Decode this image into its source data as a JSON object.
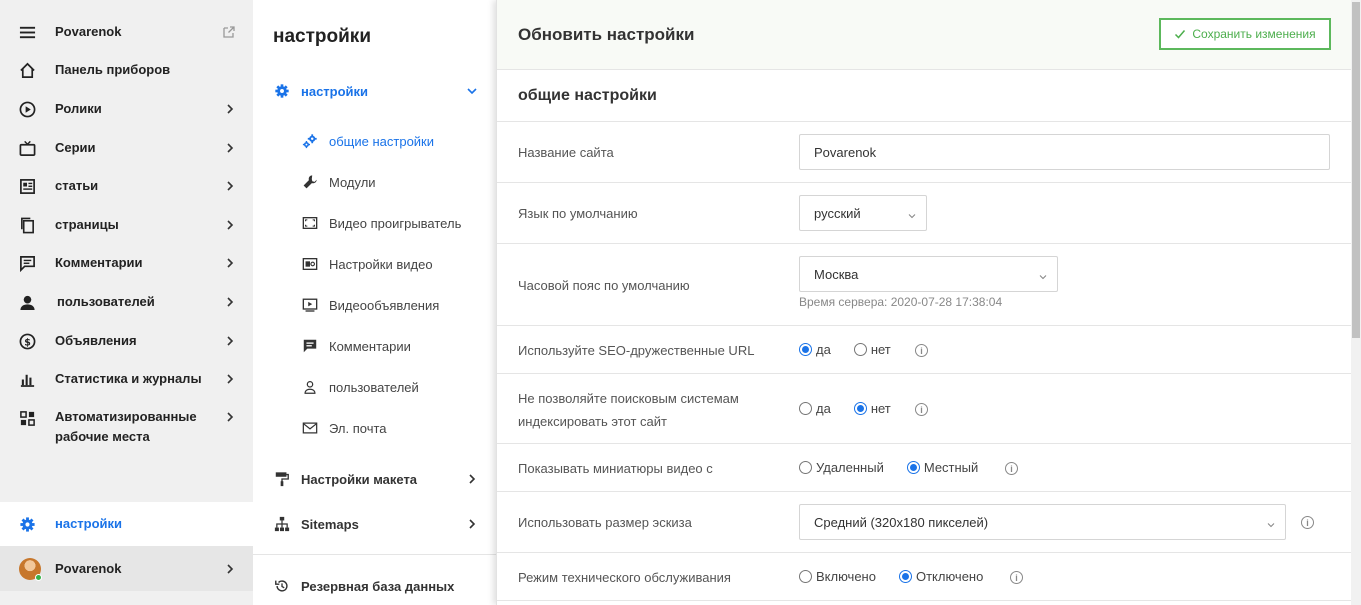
{
  "sidebar": {
    "items": [
      {
        "label": "Povarenok",
        "icon": "menu-icon"
      },
      {
        "label": "Панель приборов",
        "icon": "home-icon"
      },
      {
        "label": "Ролики",
        "icon": "play-circle-icon"
      },
      {
        "label": "Серии",
        "icon": "tv-icon"
      },
      {
        "label": "статьи",
        "icon": "newspaper-icon"
      },
      {
        "label": "страницы",
        "icon": "pages-icon"
      },
      {
        "label": "Комментарии",
        "icon": "comment-icon"
      },
      {
        "label": "пользователей",
        "icon": "user-icon"
      },
      {
        "label": "Объявления",
        "icon": "dollar-icon"
      },
      {
        "label": "Статистика и журналы",
        "icon": "bar-chart-icon"
      },
      {
        "label": "Автоматизированные рабочие места",
        "label_line1": "Автоматизированные",
        "label_line2": "рабочие места",
        "icon": "workstation-icon"
      }
    ],
    "settings_label": "настройки",
    "user_label": "Povarenok"
  },
  "settings_menu": {
    "title": "настройки",
    "settings_group": "настройки",
    "sub_items": [
      {
        "label": "общие настройки",
        "icon": "gears-icon"
      },
      {
        "label": "Модули",
        "icon": "wrench-icon"
      },
      {
        "label": "Видео проигрыватель",
        "icon": "video-player-icon"
      },
      {
        "label": "Настройки видео",
        "icon": "video-settings-icon"
      },
      {
        "label": "Видеообъявления",
        "icon": "video-ad-icon"
      },
      {
        "label": "Комментарии",
        "icon": "comment-icon"
      },
      {
        "label": "пользователей",
        "icon": "user-icon"
      },
      {
        "label": "Эл. почта",
        "icon": "mail-icon"
      }
    ],
    "layout_settings": "Настройки макета",
    "sitemaps": "Sitemaps",
    "backup": "Резервная база данных"
  },
  "panel": {
    "title": "Обновить настройки",
    "save_label": "Сохранить изменения",
    "section_title": "общие настройки",
    "site_name_label": "Название сайта",
    "site_name_value": "Povarenok",
    "language_label": "Язык по умолчанию",
    "language_value": "русский",
    "timezone_label": "Часовой пояс по умолчанию",
    "timezone_value": "Москва",
    "server_time": "Время сервера: 2020-07-28 17:38:04",
    "seo_label": "Используйте SEO-дружественные URL",
    "seo_yes": "да",
    "seo_no": "нет",
    "seo_selected": "yes",
    "noindex_label_line1": "Не позволяйте поисковым системам",
    "noindex_label_line2": "индексировать этот сайт",
    "noindex_yes": "да",
    "noindex_no": "нет",
    "noindex_selected": "no",
    "thumbs_label": "Показывать миниатюры видео с",
    "thumbs_remote": "Удаленный",
    "thumbs_local": "Местный",
    "thumbs_selected": "local",
    "thumb_size_label": "Использовать размер эскиза",
    "thumb_size_value": "Средний (320x180 пикселей)",
    "maintenance_label": "Режим технического обслуживания",
    "maintenance_on": "Включено",
    "maintenance_off": "Отключено",
    "maintenance_selected": "off"
  },
  "colors": {
    "accent": "#1a73e8",
    "save_green": "#5cb85c",
    "nav_bg": "#f0f0f0"
  }
}
